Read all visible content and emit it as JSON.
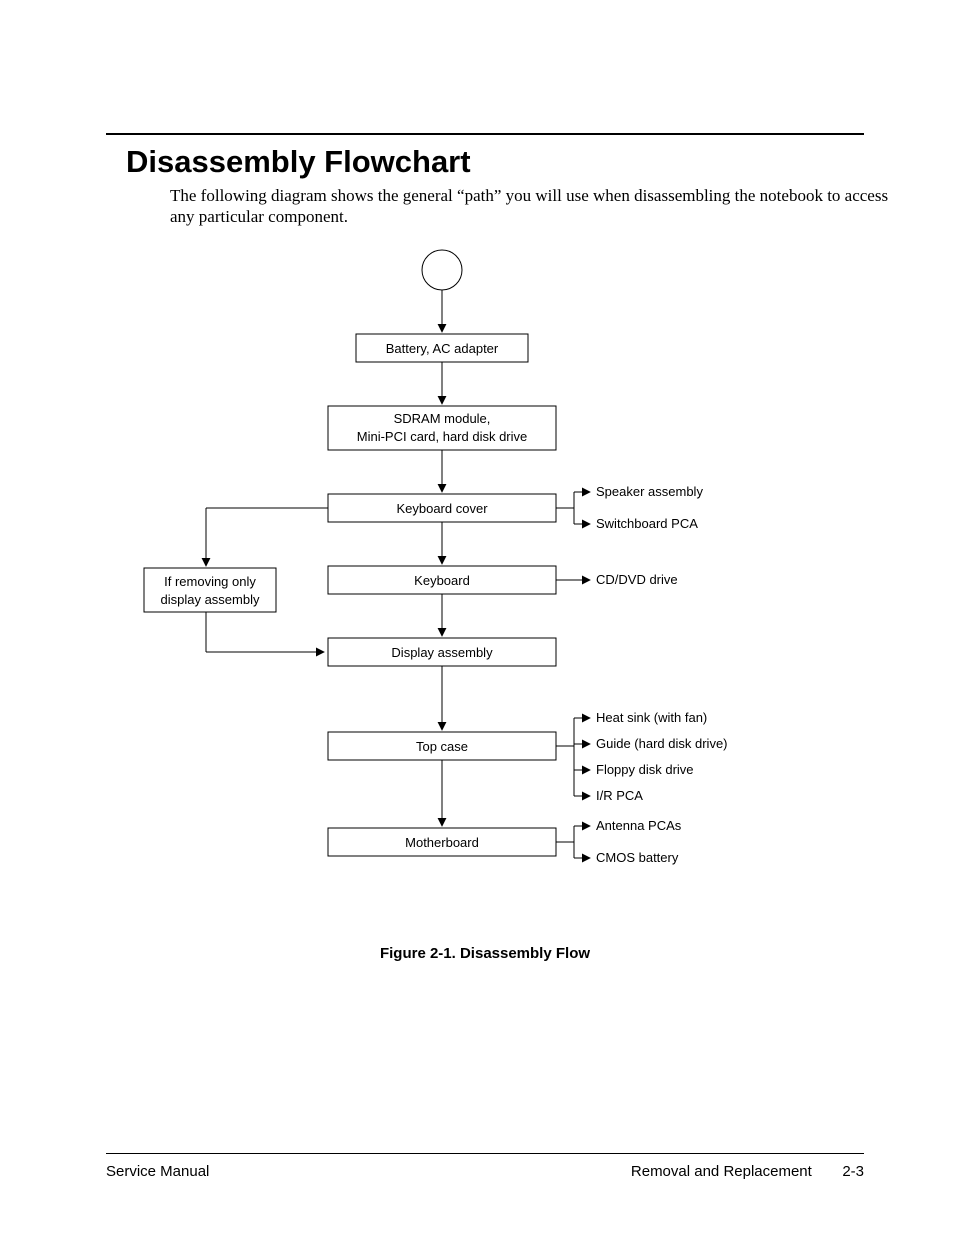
{
  "title": "Disassembly Flowchart",
  "intro": "The following diagram shows the general “path” you will use when disassembling the notebook to access any particular component.",
  "caption": "Figure 2-1. Disassembly Flow",
  "footer": {
    "left": "Service Manual",
    "right": "Removal and Replacement",
    "page": "2-3"
  },
  "flow": {
    "n1": "Battery, AC adapter",
    "n2a": "SDRAM module,",
    "n2b": "Mini-PCI card, hard disk drive",
    "n3": "Keyboard cover",
    "n4": "Keyboard",
    "n5": "Display assembly",
    "n6": "Top case",
    "n7": "Motherboard",
    "sidea": "If removing only",
    "sideb": "display assembly",
    "r3a": "Speaker assembly",
    "r3b": "Switchboard PCA",
    "r4a": "CD/DVD drive",
    "r6a": "Heat sink (with fan)",
    "r6b": "Guide (hard disk drive)",
    "r6c": "Floppy disk drive",
    "r6d": "I/R PCA",
    "r7a": "Antenna PCAs",
    "r7b": "CMOS battery"
  }
}
